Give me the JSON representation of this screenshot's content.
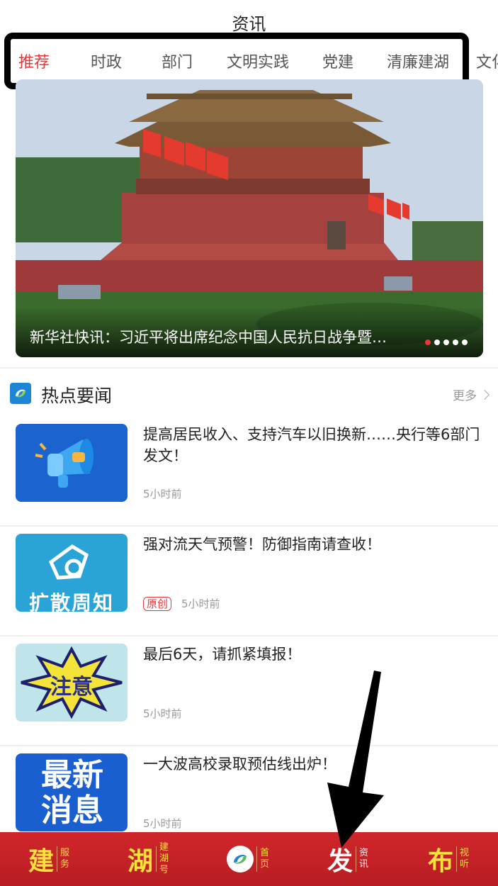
{
  "header": {
    "title": "资讯"
  },
  "tabs": [
    {
      "label": "推荐",
      "active": true
    },
    {
      "label": "时政"
    },
    {
      "label": "部门"
    },
    {
      "label": "文明实践"
    },
    {
      "label": "党建"
    },
    {
      "label": "清廉建湖"
    },
    {
      "label": "文化"
    }
  ],
  "banner": {
    "caption": "新华社快讯：习近平将出席纪念中国人民抗日战争暨…",
    "dots_total": 5,
    "dots_active_index": 0
  },
  "hot_news": {
    "title": "热点要闻",
    "more_label": "更多",
    "items": [
      {
        "title": "提高居民收入、支持汽车以旧换新……央行等6部门发文！",
        "time": "5小时前",
        "badge": ""
      },
      {
        "title": "强对流天气预警！防御指南请查收！",
        "time": "5小时前",
        "badge": "原创",
        "thumb_text": "扩散周知"
      },
      {
        "title": "最后6天，请抓紧填报！",
        "time": "5小时前",
        "badge": "",
        "thumb_text": "注意"
      },
      {
        "title": "一大波高校录取预估线出炉！",
        "time": "5小时前",
        "badge": "",
        "thumb_text": "最新消息"
      }
    ]
  },
  "bottom_nav": [
    {
      "big": "建",
      "small": "服务"
    },
    {
      "big": "湖",
      "small": "建湖号"
    },
    {
      "icon": "home-logo-icon",
      "small": "首页"
    },
    {
      "big": "发",
      "small": "资讯"
    },
    {
      "big": "布",
      "small": "视听"
    }
  ],
  "colors": {
    "accent": "#e8373a",
    "nav_bg": "#c8232a",
    "nav_text": "#f7e23c"
  }
}
